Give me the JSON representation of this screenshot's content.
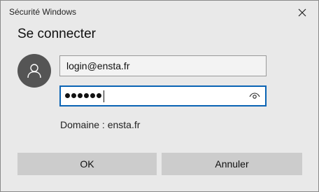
{
  "window": {
    "title": "Sécurité Windows"
  },
  "dialog": {
    "heading": "Se connecter",
    "login_value": "login@ensta.fr",
    "password_mask_count": 6,
    "domain_text": "Domaine : ensta.fr",
    "ok_label": "OK",
    "cancel_label": "Annuler"
  },
  "icons": {
    "close": "close-icon",
    "user": "user-icon",
    "reveal_password": "eye-icon"
  },
  "colors": {
    "background": "#e9e9e9",
    "avatar": "#555555",
    "focus_border": "#0a64b4",
    "button": "#cccccc"
  }
}
